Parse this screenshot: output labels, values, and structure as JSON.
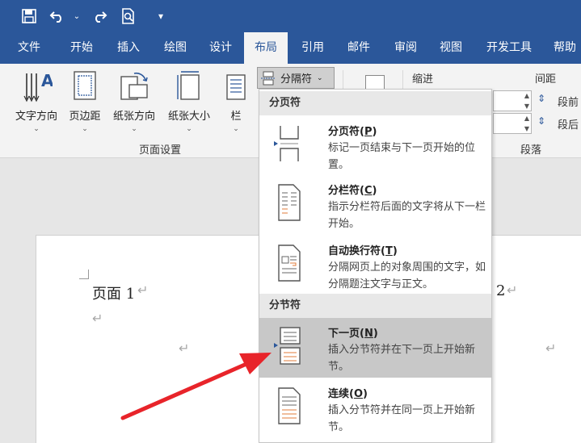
{
  "quick_access": {
    "save_icon": "save-icon",
    "undo_icon": "undo-icon",
    "redo_icon": "redo-icon",
    "preview_icon": "print-preview-icon",
    "customize_glyph": "▾"
  },
  "tabs": [
    {
      "label": "文件"
    },
    {
      "label": "开始"
    },
    {
      "label": "插入"
    },
    {
      "label": "绘图"
    },
    {
      "label": "设计"
    },
    {
      "label": "布局"
    },
    {
      "label": "引用"
    },
    {
      "label": "邮件"
    },
    {
      "label": "审阅"
    },
    {
      "label": "视图"
    },
    {
      "label": "开发工具"
    },
    {
      "label": "帮助"
    }
  ],
  "ribbon": {
    "text_direction": "文字方向",
    "margins": "页边距",
    "orientation": "纸张方向",
    "size": "纸张大小",
    "columns": "栏",
    "page_setup_group": "页面设置",
    "breaks_button": "分隔符",
    "indent_label": "缩进",
    "spacing_label": "间距",
    "before_label": "段前",
    "after_label": "段后",
    "paragraph_group": "段落"
  },
  "menu": {
    "page_breaks_header": "分页符",
    "section_breaks_header": "分节符",
    "items": [
      {
        "title": "分页符",
        "key": "P",
        "desc": "标记一页结束与下一页开始的位置。"
      },
      {
        "title": "分栏符",
        "key": "C",
        "desc": "指示分栏符后面的文字将从下一栏开始。"
      },
      {
        "title": "自动换行符",
        "key": "T",
        "desc": "分隔网页上的对象周围的文字，如分隔题注文字与正文。"
      },
      {
        "title": "下一页",
        "key": "N",
        "desc": "插入分节符并在下一页上开始新节。"
      },
      {
        "title": "连续",
        "key": "O",
        "desc": "插入分节符并在同一页上开始新节。"
      }
    ]
  },
  "document": {
    "page1_text": "页面 1",
    "page2_text": "2",
    "pilcrow": "↵"
  },
  "colors": {
    "accent": "#2b579a",
    "annotation_arrow": "#e8242a",
    "break_marker": "#e07b39"
  }
}
